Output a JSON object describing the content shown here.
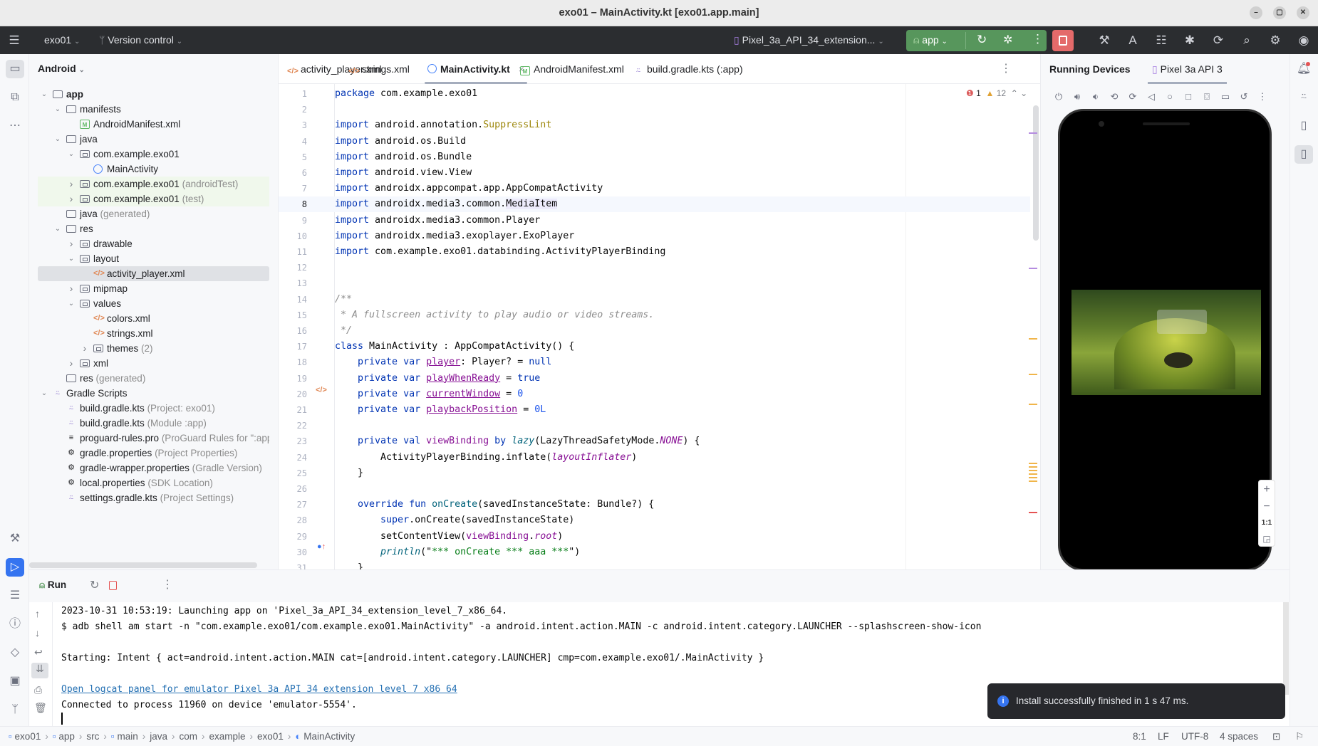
{
  "window": {
    "title": "exo01 – MainActivity.kt [exo01.app.main]"
  },
  "toolbar": {
    "project": "exo01",
    "vcs": "Version control",
    "device": "Pixel_3a_API_34_extension...",
    "run_config": "app",
    "icons": [
      "hamburger-menu-icon",
      "build-icon",
      "translate-icon",
      "layout-inspector-icon",
      "app-quality-icon",
      "gradle-sync-icon",
      "search-icon",
      "settings-icon",
      "account-icon"
    ]
  },
  "colors": {
    "run_green": "#57965c",
    "stop_red": "#e46a6a",
    "toolbar_dark": "#2b2d30",
    "accent_blue": "#3574f0"
  },
  "project": {
    "view": "Android",
    "tree": [
      {
        "level": 0,
        "chev": "open",
        "icon": "folder",
        "name": "app",
        "bold": true
      },
      {
        "level": 1,
        "chev": "open",
        "icon": "folder",
        "name": "manifests"
      },
      {
        "level": 2,
        "chev": "",
        "icon": "manifest",
        "name": "AndroidManifest.xml"
      },
      {
        "level": 1,
        "chev": "open",
        "icon": "folder",
        "name": "java"
      },
      {
        "level": 2,
        "chev": "open",
        "icon": "package",
        "name": "com.example.exo01"
      },
      {
        "level": 3,
        "chev": "",
        "icon": "kotlin",
        "name": "MainActivity"
      },
      {
        "level": 2,
        "chev": "closed",
        "icon": "package",
        "name": "com.example.exo01",
        "hint": "(androidTest)",
        "test": true
      },
      {
        "level": 2,
        "chev": "closed",
        "icon": "package",
        "name": "com.example.exo01",
        "hint": "(test)",
        "test": true
      },
      {
        "level": 1,
        "chev": "",
        "icon": "folder",
        "name": "java",
        "hint": "(generated)"
      },
      {
        "level": 1,
        "chev": "open",
        "icon": "folder",
        "name": "res"
      },
      {
        "level": 2,
        "chev": "closed",
        "icon": "package",
        "name": "drawable"
      },
      {
        "level": 2,
        "chev": "open",
        "icon": "package",
        "name": "layout"
      },
      {
        "level": 3,
        "chev": "",
        "icon": "xml",
        "name": "activity_player.xml",
        "selected": true
      },
      {
        "level": 2,
        "chev": "closed",
        "icon": "package",
        "name": "mipmap"
      },
      {
        "level": 2,
        "chev": "open",
        "icon": "package",
        "name": "values"
      },
      {
        "level": 3,
        "chev": "",
        "icon": "xml",
        "name": "colors.xml"
      },
      {
        "level": 3,
        "chev": "",
        "icon": "xml",
        "name": "strings.xml"
      },
      {
        "level": 3,
        "chev": "closed",
        "icon": "package",
        "name": "themes",
        "hint": "(2)"
      },
      {
        "level": 2,
        "chev": "closed",
        "icon": "package",
        "name": "xml"
      },
      {
        "level": 1,
        "chev": "",
        "icon": "folder",
        "name": "res",
        "hint": "(generated)"
      },
      {
        "level": 0,
        "chev": "open",
        "icon": "gradle",
        "name": "Gradle Scripts"
      },
      {
        "level": 1,
        "chev": "",
        "icon": "gradle",
        "name": "build.gradle.kts",
        "hint": "(Project: exo01)"
      },
      {
        "level": 1,
        "chev": "",
        "icon": "gradle",
        "name": "build.gradle.kts",
        "hint": "(Module :app)"
      },
      {
        "level": 1,
        "chev": "",
        "icon": "text",
        "name": "proguard-rules.pro",
        "hint": "(ProGuard Rules for \":app\")"
      },
      {
        "level": 1,
        "chev": "",
        "icon": "gear",
        "name": "gradle.properties",
        "hint": "(Project Properties)"
      },
      {
        "level": 1,
        "chev": "",
        "icon": "gear",
        "name": "gradle-wrapper.properties",
        "hint": "(Gradle Version)"
      },
      {
        "level": 1,
        "chev": "",
        "icon": "gear",
        "name": "local.properties",
        "hint": "(SDK Location)"
      },
      {
        "level": 1,
        "chev": "",
        "icon": "gradle",
        "name": "settings.gradle.kts",
        "hint": "(Project Settings)"
      }
    ]
  },
  "editor": {
    "tabs": [
      {
        "label": "activity_player.xml",
        "icon": "xml"
      },
      {
        "label": "strings.xml",
        "icon": "xml"
      },
      {
        "label": "MainActivity.kt",
        "icon": "kotlin",
        "active": true,
        "close": "×"
      },
      {
        "label": "AndroidManifest.xml",
        "icon": "manifest"
      },
      {
        "label": "build.gradle.kts (:app)",
        "icon": "gradle"
      }
    ],
    "errors": "1",
    "warnings": "12",
    "current_line": 8,
    "lines": [
      [
        [
          "package",
          "kw"
        ],
        [
          " com.example.exo01",
          ""
        ]
      ],
      [],
      [
        [
          "import",
          "kw"
        ],
        [
          " android.annotation.",
          ""
        ],
        [
          "SuppressLint",
          "ann"
        ]
      ],
      [
        [
          "import",
          "kw"
        ],
        [
          " android.os.Build",
          ""
        ]
      ],
      [
        [
          "import",
          "kw"
        ],
        [
          " android.os.Bundle",
          ""
        ]
      ],
      [
        [
          "import",
          "kw"
        ],
        [
          " android.view.View",
          ""
        ]
      ],
      [
        [
          "import",
          "kw"
        ],
        [
          " androidx.appcompat.app.AppCompatActivity",
          ""
        ]
      ],
      [
        [
          "import",
          "kw"
        ],
        [
          " androidx.media3.common.",
          ""
        ],
        [
          "MediaItem",
          "hl"
        ]
      ],
      [
        [
          "import",
          "kw"
        ],
        [
          " androidx.media3.common.Player",
          ""
        ]
      ],
      [
        [
          "import",
          "kw"
        ],
        [
          " androidx.media3.exoplayer.ExoPlayer",
          ""
        ]
      ],
      [
        [
          "import",
          "kw"
        ],
        [
          " com.example.exo01.databinding.ActivityPlayerBinding",
          ""
        ]
      ],
      [],
      [],
      [
        [
          "/**",
          "cm"
        ]
      ],
      [
        [
          " * A fullscreen activity to play audio or video streams.",
          "cm"
        ]
      ],
      [
        [
          " */",
          "cm"
        ]
      ],
      [
        [
          "class",
          "kw"
        ],
        [
          " MainActivity : AppCompatActivity() {",
          ""
        ]
      ],
      [
        [
          "    private var ",
          "kw"
        ],
        [
          "player",
          "prop"
        ],
        [
          ": Player? = ",
          ""
        ],
        [
          "null",
          "kw"
        ]
      ],
      [
        [
          "    private var ",
          "kw"
        ],
        [
          "playWhenReady",
          "prop"
        ],
        [
          " = ",
          ""
        ],
        [
          "true",
          "kw"
        ]
      ],
      [
        [
          "    private var ",
          "kw"
        ],
        [
          "currentWindow",
          "prop"
        ],
        [
          " = ",
          ""
        ],
        [
          "0",
          "num"
        ]
      ],
      [
        [
          "    private var ",
          "kw"
        ],
        [
          "playbackPosition",
          "prop"
        ],
        [
          " = ",
          ""
        ],
        [
          "0L",
          "num"
        ]
      ],
      [],
      [
        [
          "    private val ",
          "kw"
        ],
        [
          "viewBinding",
          "prop2"
        ],
        [
          " by ",
          "kw"
        ],
        [
          "lazy",
          "itf"
        ],
        [
          "(LazyThreadSafetyMode.",
          ""
        ],
        [
          "NONE",
          "it"
        ],
        [
          ") {",
          ""
        ]
      ],
      [
        [
          "        ActivityPlayerBinding.inflate(",
          ""
        ],
        [
          "layoutInflater",
          "it"
        ],
        [
          ")",
          ""
        ]
      ],
      [
        [
          "    }",
          ""
        ]
      ],
      [],
      [
        [
          "    override fun ",
          "kw"
        ],
        [
          "onCreate",
          "fn"
        ],
        [
          "(savedInstanceState: Bundle?) {",
          ""
        ]
      ],
      [
        [
          "        super",
          "kw"
        ],
        [
          ".onCreate(savedInstanceState)",
          ""
        ]
      ],
      [
        [
          "        setContentView(",
          ""
        ],
        [
          "viewBinding",
          "prop2"
        ],
        [
          ".",
          ""
        ],
        [
          "root",
          "it"
        ],
        [
          ")",
          ""
        ]
      ],
      [
        [
          "        println",
          "itf"
        ],
        [
          "(\"",
          ""
        ],
        [
          "*** onCreate *** aaa ***",
          "str"
        ],
        [
          "\")",
          ""
        ]
      ],
      [
        [
          "    }",
          ""
        ]
      ]
    ]
  },
  "devices": {
    "title": "Running Devices",
    "tab": "Pixel 3a API 3",
    "zoom_label": "1:1",
    "controls": [
      "power-icon",
      "volume-up-icon",
      "volume-down-icon",
      "rotate-left-icon",
      "rotate-right-icon",
      "back-icon",
      "home-icon",
      "overview-icon",
      "screenshot-icon",
      "screen-record-icon",
      "reset-icon",
      "more-icon"
    ]
  },
  "run": {
    "label": "Run",
    "console": [
      {
        "text": "2023-10-31 10:53:19: Launching app on 'Pixel_3a_API_34_extension_level_7_x86_64."
      },
      {
        "text": "$ adb shell am start -n \"com.example.exo01/com.example.exo01.MainActivity\" -a android.intent.action.MAIN -c android.intent.category.LAUNCHER --splashscreen-show-icon"
      },
      {
        "text": ""
      },
      {
        "text": "Starting: Intent { act=android.intent.action.MAIN cat=[android.intent.category.LAUNCHER] cmp=com.example.exo01/.MainActivity }"
      },
      {
        "text": ""
      },
      {
        "text": "Open logcat panel for emulator Pixel 3a API 34 extension level 7 x86 64",
        "link": true
      },
      {
        "text": "Connected to process 11960 on device 'emulator-5554'."
      }
    ]
  },
  "toast": {
    "message": "Install successfully finished in 1 s 47 ms."
  },
  "status": {
    "breadcrumbs": [
      "exo01",
      "app",
      "src",
      "main",
      "java",
      "com",
      "example",
      "exo01",
      "MainActivity"
    ],
    "position": "8:1",
    "line_sep": "LF",
    "encoding": "UTF-8",
    "indent": "4 spaces"
  }
}
